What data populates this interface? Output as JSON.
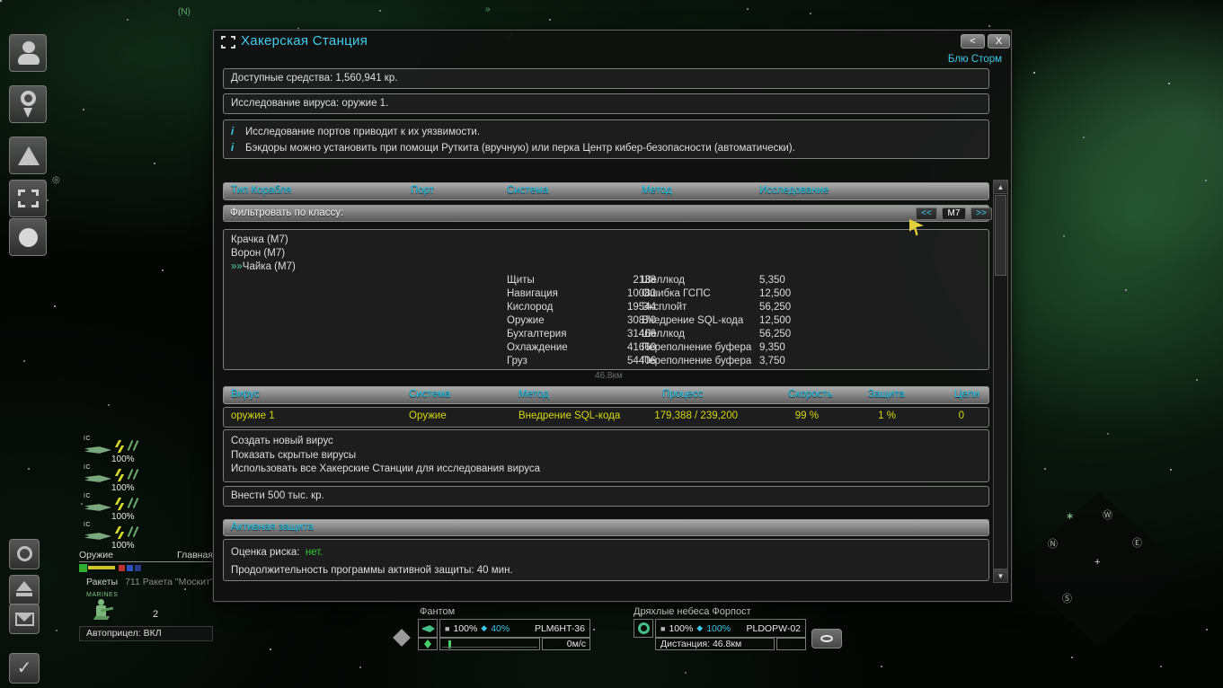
{
  "hud": {
    "markers": [
      "(N)",
      "»",
      "↗",
      "◎"
    ],
    "background_distance": "46.8км",
    "wing": {
      "tag": "IC",
      "entries": [
        {
          "hull": "100%"
        },
        {
          "hull": "100%"
        },
        {
          "hull": "100%"
        },
        {
          "hull": "100%"
        }
      ],
      "weapons_tab": "Оружие",
      "main_tab": "Главная",
      "rockets_label": "Ракеты",
      "rockets_value": "711 Ракета \"Москит\"",
      "marines_label": "MARINES",
      "marines_count": "2",
      "autoaim": "Автоприцел: ВКЛ"
    },
    "player_target": {
      "name": "Фантом",
      "hull_icon": "■",
      "hull": "100%",
      "shield_icon": "◆",
      "shield": "40%",
      "id": "PLM6HT-36",
      "speed": "0м/с"
    },
    "station_target": {
      "name": "Дряхлые небеса Форпост",
      "hull_icon": "■",
      "hull": "100%",
      "shield_icon": "◆",
      "shield": "100%",
      "id": "PLDOPW-02",
      "distance": "Дистанция: 46.8км"
    },
    "radar": {
      "glyphs": [
        "∗",
        "Ⓦ",
        "Ⓝ",
        "Ⓔ",
        "+",
        "Ⓢ"
      ]
    }
  },
  "dialog": {
    "title": "Хакерская Станция",
    "owner": "Блю Сторм",
    "back_button": "<",
    "close_button": "X",
    "funds": "Доступные средства: 1,560,941 кр.",
    "research": "Исследование вируса: оружие 1.",
    "info_icon": "i",
    "info_lines": [
      "Исследование портов приводит к их уязвимости.",
      "Бэкдоры можно установить при помощи Руткита (вручную) или перка Центр кибер-безопасности (автоматически)."
    ],
    "ports_table": {
      "headers": [
        "Тип Корабля",
        "Порт",
        "Система",
        "Метод",
        "Исследование"
      ],
      "filter": {
        "label": "Фильтровать по классу:",
        "prev": "<<",
        "value": "M7",
        "next": ">>"
      },
      "ships": [
        {
          "prefix": "",
          "name": "Крачка (M7)"
        },
        {
          "prefix": "",
          "name": "Ворон (M7)"
        },
        {
          "prefix": "»»",
          "name": "Чайка (M7)"
        }
      ],
      "rows": [
        {
          "port": "2138",
          "system": "Щиты",
          "method": "Шеллкод",
          "research": "5,350"
        },
        {
          "port": "10080",
          "system": "Навигация",
          "method": "Ошибка ГСПС",
          "research": "12,500"
        },
        {
          "port": "19544",
          "system": "Кислород",
          "method": "Эксплойт",
          "research": "56,250"
        },
        {
          "port": "30870",
          "system": "Оружие",
          "method": "Внедрение SQL-кода",
          "research": "12,500"
        },
        {
          "port": "31466",
          "system": "Бухгалтерия",
          "method": "Шеллкод",
          "research": "56,250"
        },
        {
          "port": "41660",
          "system": "Охлаждение",
          "method": "Переполнение буфера",
          "research": "9,350"
        },
        {
          "port": "54406",
          "system": "Груз",
          "method": "Переполнение буфера",
          "research": "3,750"
        }
      ]
    },
    "virus_table": {
      "headers": [
        "Вирус",
        "Система",
        "Метод",
        "Процесс",
        "Скорость",
        "Защита",
        "Цели"
      ],
      "row": {
        "virus": "оружие 1",
        "system": "Оружие",
        "method": "Внедрение SQL-кода",
        "process": "179,388 / 239,200",
        "speed": "99 %",
        "defense": "1 %",
        "targets": "0"
      }
    },
    "actions": [
      "Создать новый вирус",
      "Показать скрытые вирусы",
      "Использовать все Хакерские Станции для исследования вируса"
    ],
    "deposit": "Внести 500 тыс. кр.",
    "active_defense": {
      "header": "Активная защита",
      "risk_label": "Оценка риска:",
      "risk_value": "нет.",
      "duration": "Продолжительность программы активной защиты: 40 мин."
    }
  }
}
